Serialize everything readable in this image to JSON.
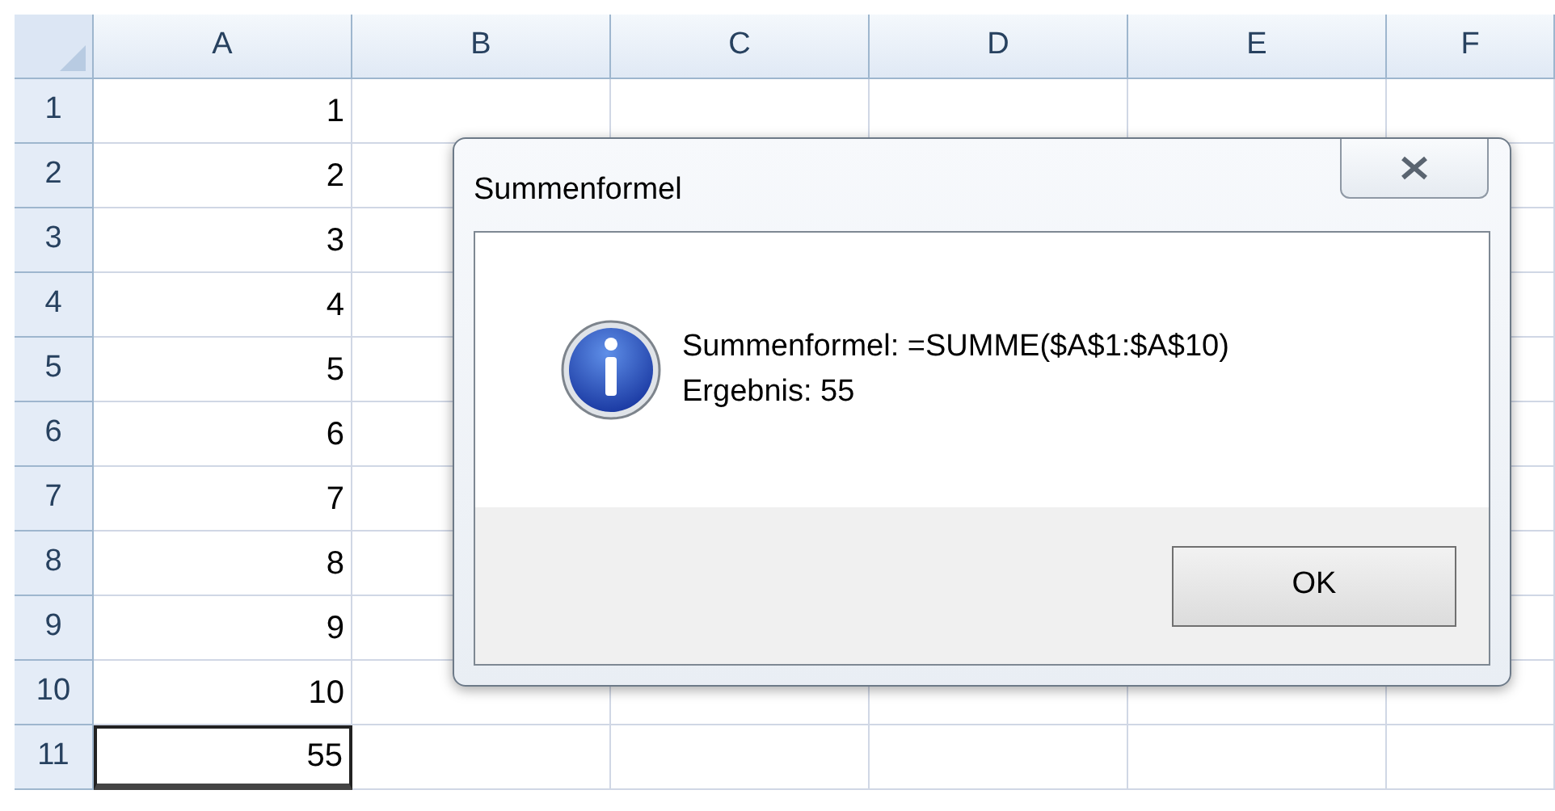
{
  "sheet": {
    "columns": [
      "A",
      "B",
      "C",
      "D",
      "E",
      "F"
    ],
    "rows": [
      {
        "header": "1",
        "value": "1",
        "selected": false
      },
      {
        "header": "2",
        "value": "2",
        "selected": false
      },
      {
        "header": "3",
        "value": "3",
        "selected": false
      },
      {
        "header": "4",
        "value": "4",
        "selected": false
      },
      {
        "header": "5",
        "value": "5",
        "selected": false
      },
      {
        "header": "6",
        "value": "6",
        "selected": false
      },
      {
        "header": "7",
        "value": "7",
        "selected": false
      },
      {
        "header": "8",
        "value": "8",
        "selected": false
      },
      {
        "header": "9",
        "value": "9",
        "selected": false
      },
      {
        "header": "10",
        "value": "10",
        "selected": false
      },
      {
        "header": "11",
        "value": "55",
        "selected": true
      }
    ]
  },
  "dialog": {
    "title": "Summenformel",
    "message": [
      "Summenformel: =SUMME($A$1:$A$10)",
      "Ergebnis: 55"
    ],
    "button": "OK"
  }
}
